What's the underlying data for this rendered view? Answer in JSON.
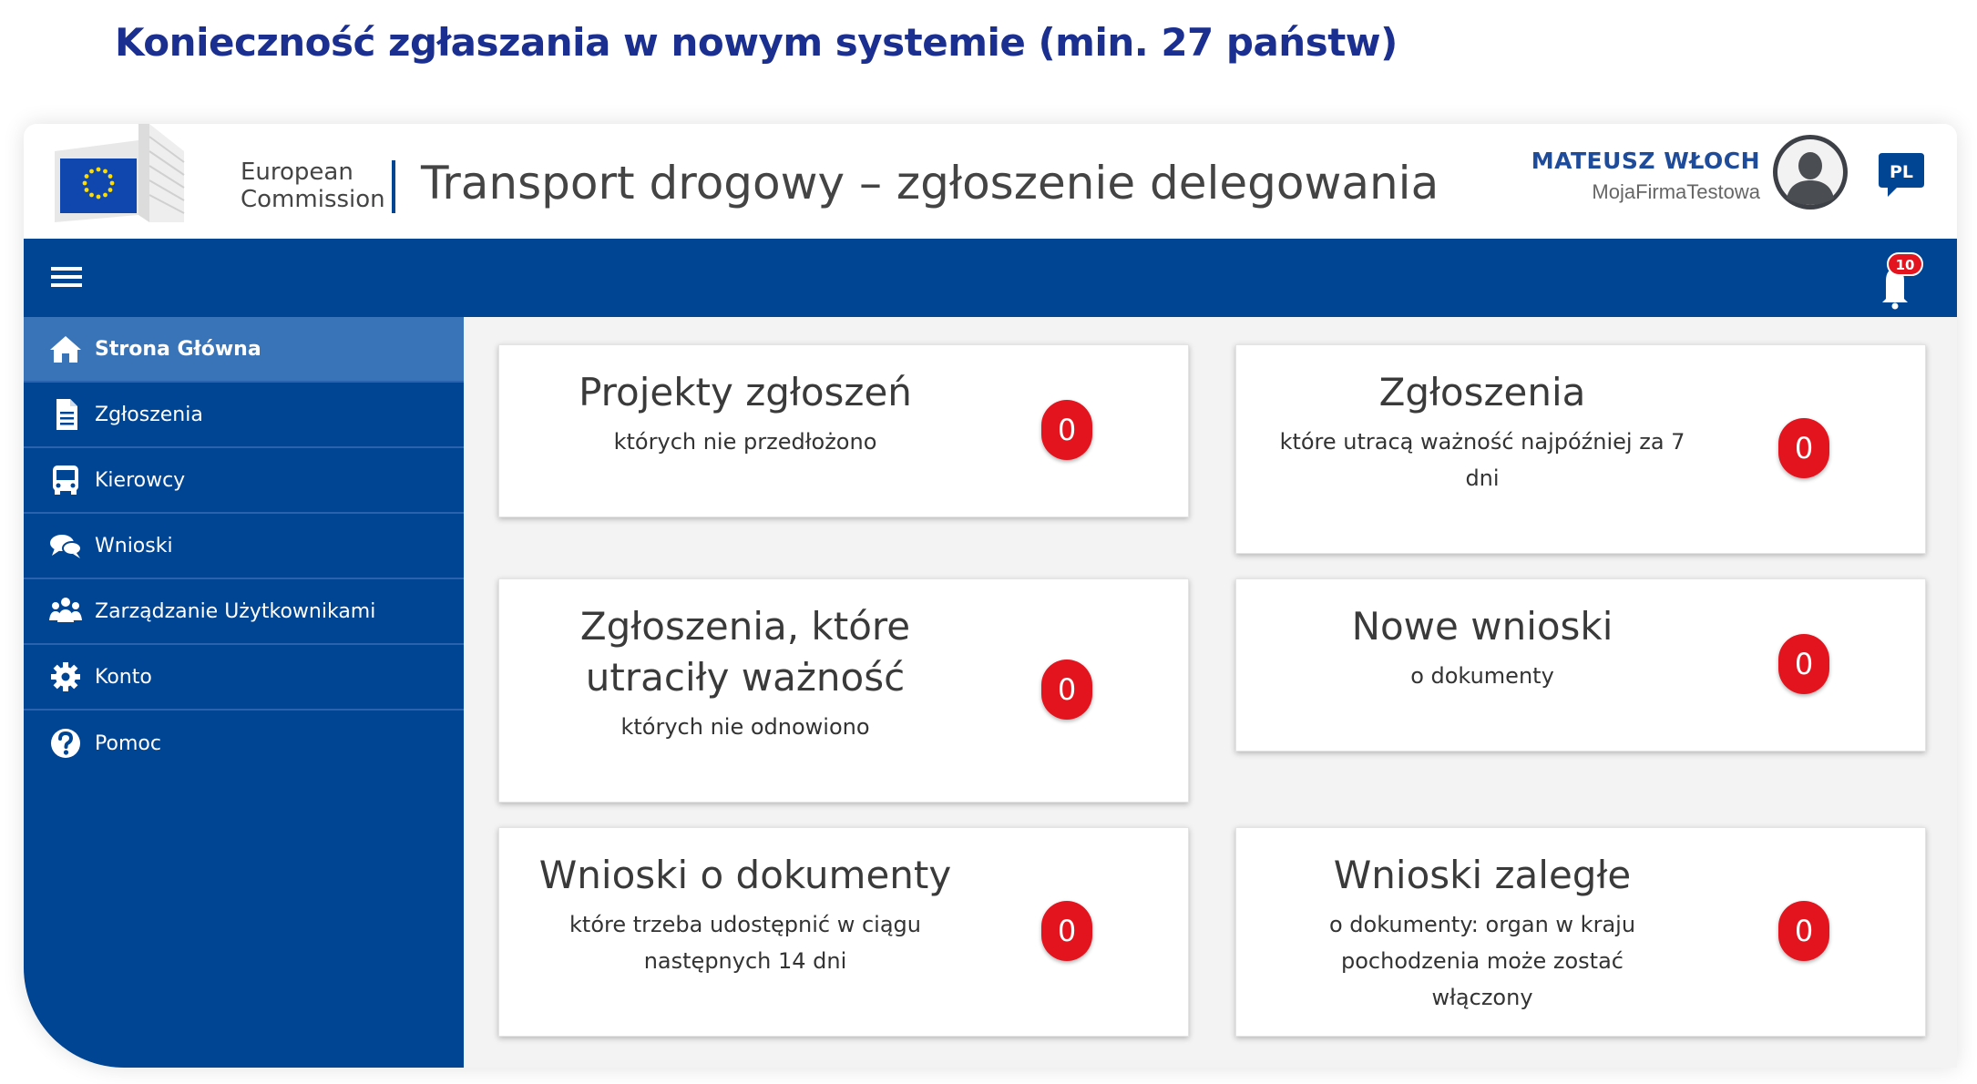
{
  "slide": {
    "title": "Konieczność zgłaszania w nowym systemie (min. 27 państw)"
  },
  "header": {
    "org_line1": "European",
    "org_line2": "Commission",
    "app_title": "Transport drogowy – zgłoszenie delegowania",
    "user_name": "MATEUSZ WŁOCH",
    "user_company": "MojaFirmaTestowa",
    "language": "PL"
  },
  "toolbar": {
    "notifications_count": "10"
  },
  "sidebar": {
    "items": [
      {
        "label": "Strona Główna",
        "icon": "home-icon",
        "active": true
      },
      {
        "label": "Zgłoszenia",
        "icon": "document-icon"
      },
      {
        "label": "Kierowcy",
        "icon": "bus-icon"
      },
      {
        "label": "Wnioski",
        "icon": "chat-bubbles-icon"
      },
      {
        "label": "Zarządzanie Użytkownikami",
        "icon": "users-icon"
      },
      {
        "label": "Konto",
        "icon": "gear-icon"
      },
      {
        "label": "Pomoc",
        "icon": "help-circle-icon"
      }
    ]
  },
  "cards": [
    {
      "title": "Projekty zgłoszeń",
      "subtitle": "których nie przedłożono",
      "count": "0"
    },
    {
      "title": "Zgłoszenia",
      "subtitle": "które utracą ważność najpóźniej za 7 dni",
      "count": "0"
    },
    {
      "title": "Zgłoszenia, które utraciły ważność",
      "subtitle": "których nie odnowiono",
      "count": "0"
    },
    {
      "title": "Nowe wnioski",
      "subtitle": "o dokumenty",
      "count": "0"
    },
    {
      "title": "Wnioski o dokumenty",
      "subtitle": "które trzeba udostępnić w ciągu następnych 14 dni",
      "count": "0"
    },
    {
      "title": "Wnioski zaległe",
      "subtitle": "o dokumenty: organ w kraju pochodzenia może zostać włączony",
      "count": "0"
    }
  ],
  "colors": {
    "brand_blue": "#004494",
    "active_nav": "#3a74b8",
    "badge_red": "#e3141e",
    "title_blue": "#1a2f8f"
  }
}
